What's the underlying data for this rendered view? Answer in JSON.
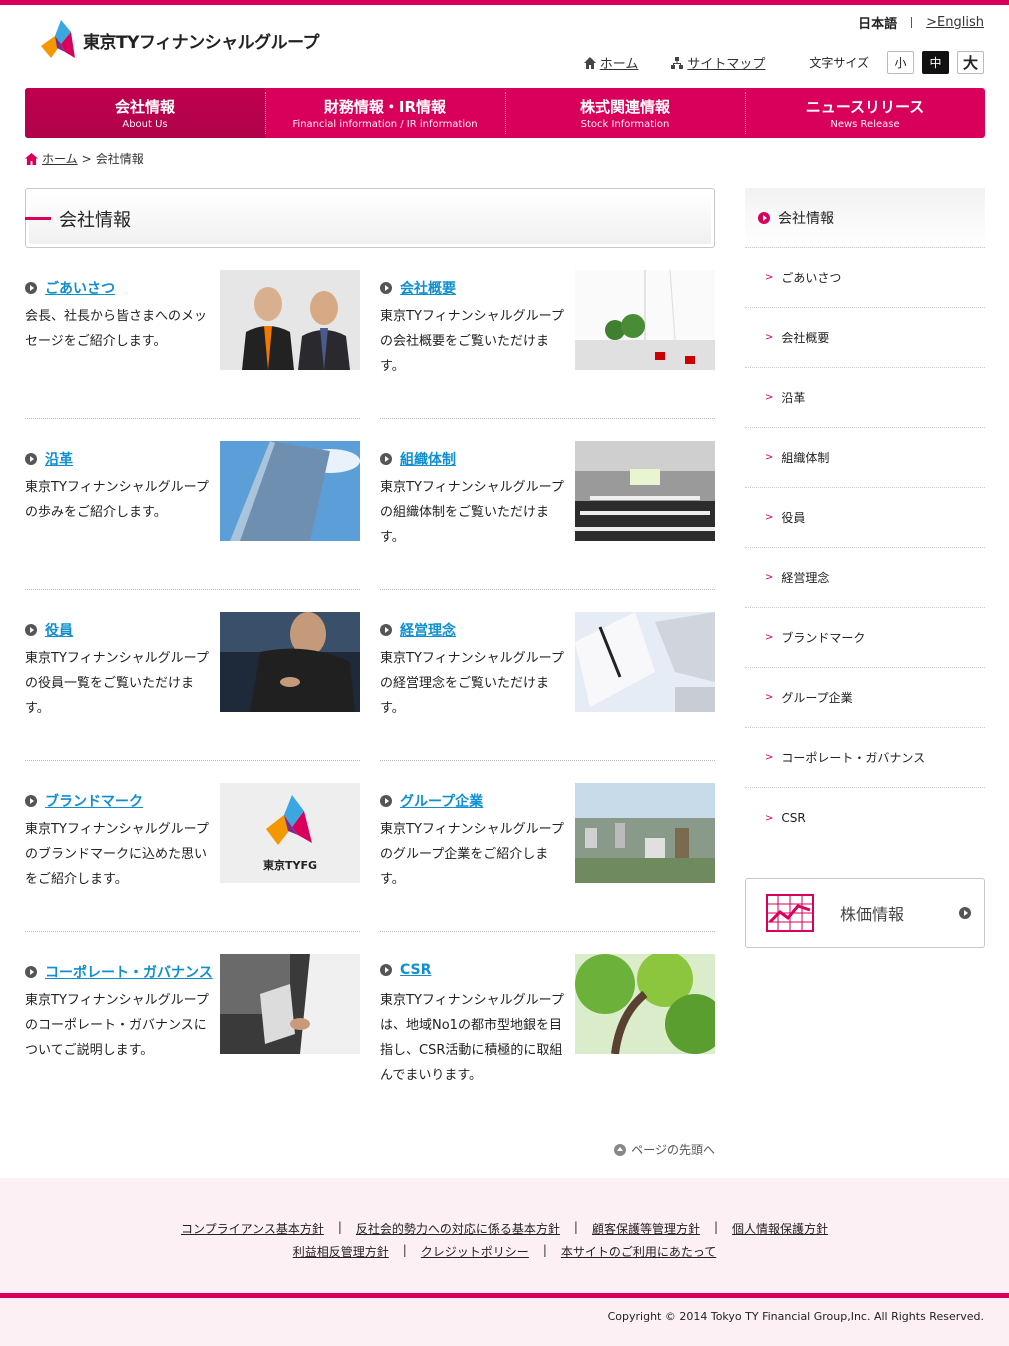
{
  "header": {
    "logo_text": "東京TYフィナンシャルグループ",
    "lang_current": "日本語",
    "lang_english": ">English",
    "home_link": "ホーム",
    "sitemap_link": "サイトマップ",
    "font_size_label": "文字サイズ",
    "font_small": "小",
    "font_medium": "中",
    "font_large": "大"
  },
  "gnav": [
    {
      "jp": "会社情報",
      "en": "About Us"
    },
    {
      "jp": "財務情報・IR情報",
      "en": "Financial information / IR information"
    },
    {
      "jp": "株式関連情報",
      "en": "Stock Information"
    },
    {
      "jp": "ニュースリリース",
      "en": "News Release"
    }
  ],
  "breadcrumb": {
    "home": "ホーム",
    "sep": ">",
    "current": "会社情報"
  },
  "page_title": "会社情報",
  "cards": [
    {
      "title": "ごあいさつ",
      "desc": "会長、社長から皆さまへのメッセージをご紹介します。"
    },
    {
      "title": "会社概要",
      "desc": "東京TYフィナンシャルグループの会社概要をご覧いただけます。"
    },
    {
      "title": "沿革",
      "desc": "東京TYフィナンシャルグループの歩みをご紹介します。"
    },
    {
      "title": "組織体制",
      "desc": "東京TYフィナンシャルグループの組織体制をご覧いただけます。"
    },
    {
      "title": "役員",
      "desc": "東京TYフィナンシャルグループの役員一覧をご覧いただけます。"
    },
    {
      "title": "経営理念",
      "desc": "東京TYフィナンシャルグループの経営理念をご覧いただけます。"
    },
    {
      "title": "ブランドマーク",
      "desc": "東京TYフィナンシャルグループのブランドマークに込めた思いをご紹介します。"
    },
    {
      "title": "グループ企業",
      "desc": "東京TYフィナンシャルグループのグループ企業をご紹介します。"
    },
    {
      "title": "コーポレート・ガバナンス",
      "desc": "東京TYフィナンシャルグループのコーポレート・ガバナンスについてご説明します。"
    },
    {
      "title": "CSR",
      "desc": "東京TYフィナンシャルグループは、地域No1の都市型地銀を目指し、CSR活動に積極的に取組んでまいります。"
    }
  ],
  "brand_logo_text": "東京TYFG",
  "sidebar": {
    "head": "会社情報",
    "items": [
      "ごあいさつ",
      "会社概要",
      "沿革",
      "組織体制",
      "役員",
      "経営理念",
      "ブランドマーク",
      "グループ企業",
      "コーポレート・ガバナンス",
      "CSR"
    ]
  },
  "stock_box_label": "株価情報",
  "pagetop": "ページの先頭へ",
  "footer": {
    "row1": [
      "コンプライアンス基本方針",
      "反社会的勢力への対応に係る基本方針",
      "顧客保護等管理方針",
      "個人情報保護方針"
    ],
    "row2": [
      "利益相反管理方針",
      "クレジットポリシー",
      "本サイトのご利用にあたって"
    ],
    "copyright": "Copyright © 2014 Tokyo TY Financial Group,Inc. All Rights Reserved."
  },
  "colors": {
    "accent": "#d9005b",
    "link": "#0f8fcf",
    "footer_bg": "#fdf0f4"
  }
}
